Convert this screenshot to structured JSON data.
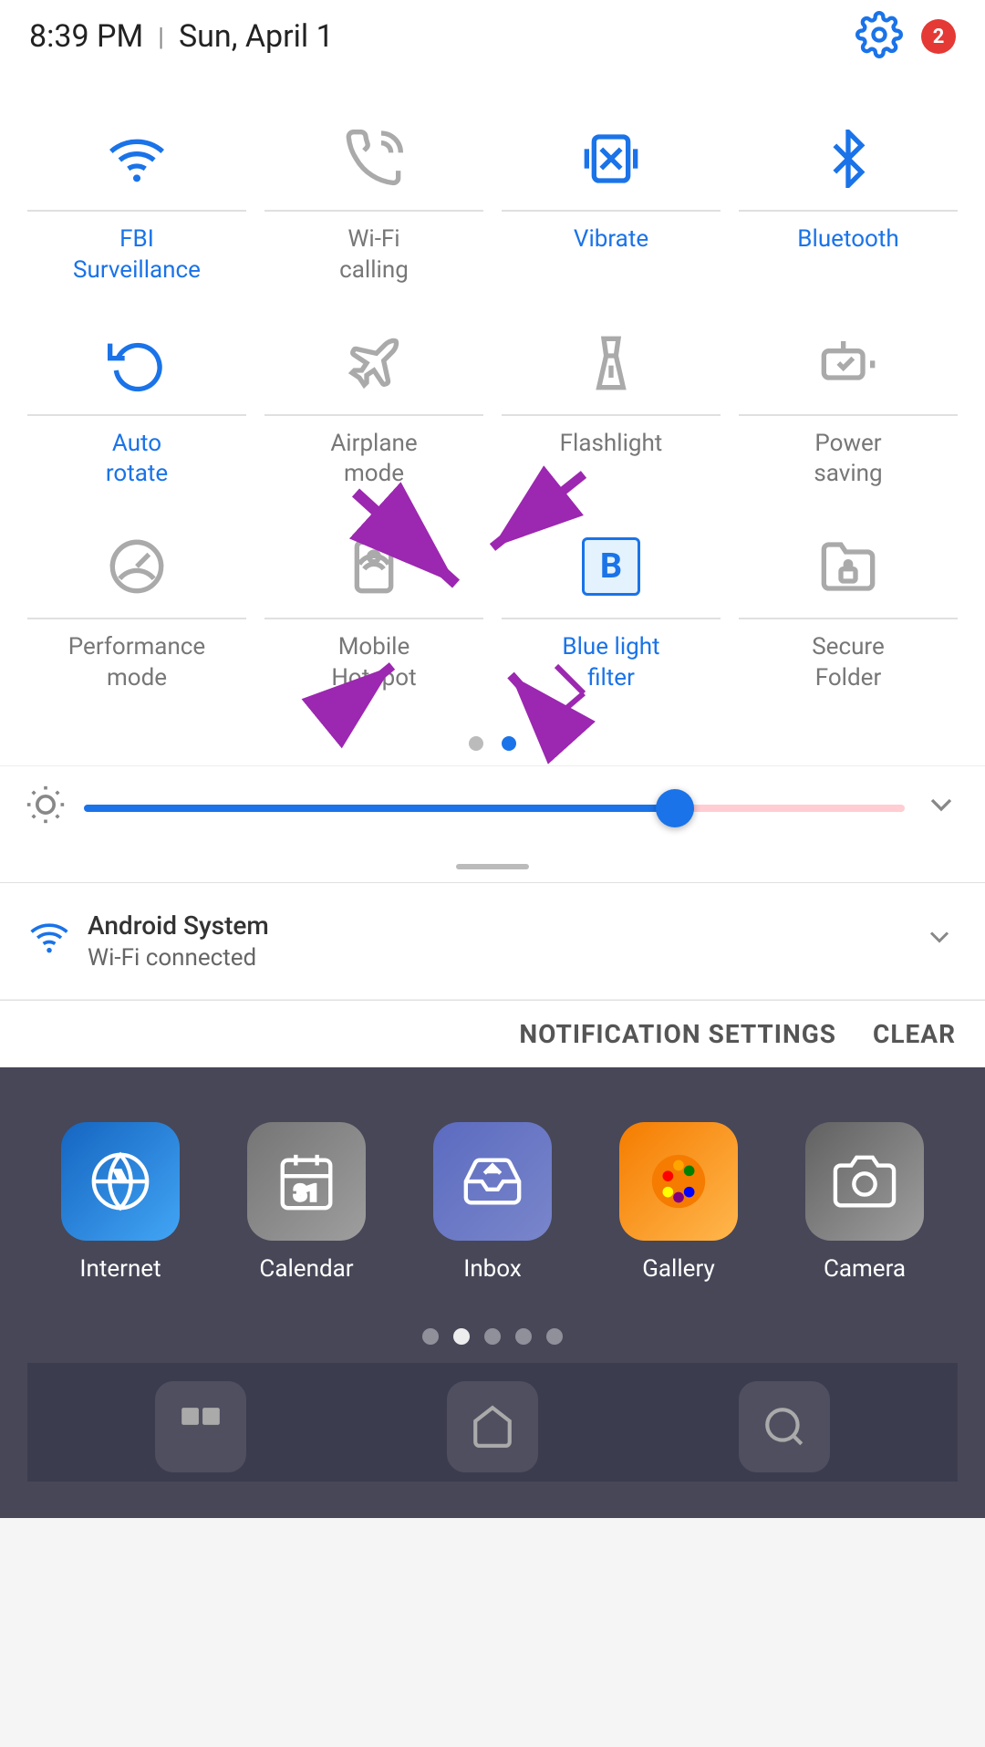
{
  "statusBar": {
    "time": "8:39 PM",
    "separator": "|",
    "date": "Sun, April 1",
    "notifCount": "2"
  },
  "quickSettings": {
    "items": [
      {
        "id": "fbi-surveillance",
        "label": "FBI\nSurveillance",
        "active": true,
        "icon": "wifi"
      },
      {
        "id": "wifi-calling",
        "label": "Wi-Fi\ncalling",
        "active": false,
        "icon": "wifi-calling"
      },
      {
        "id": "vibrate",
        "label": "Vibrate",
        "active": true,
        "icon": "vibrate"
      },
      {
        "id": "bluetooth",
        "label": "Bluetooth",
        "active": true,
        "icon": "bluetooth"
      },
      {
        "id": "auto-rotate",
        "label": "Auto\nrotate",
        "active": true,
        "icon": "auto-rotate"
      },
      {
        "id": "airplane-mode",
        "label": "Airplane\nmode",
        "active": false,
        "icon": "airplane"
      },
      {
        "id": "flashlight",
        "label": "Flashlight",
        "active": false,
        "icon": "flashlight"
      },
      {
        "id": "power-saving",
        "label": "Power\nsaving",
        "active": false,
        "icon": "battery"
      },
      {
        "id": "performance-mode",
        "label": "Performance\nmode",
        "active": false,
        "icon": "speedometer"
      },
      {
        "id": "mobile-hotspot",
        "label": "Mobile\nHotspot",
        "active": false,
        "icon": "hotspot"
      },
      {
        "id": "blue-light-filter",
        "label": "Blue light\nfilter",
        "active": true,
        "icon": "blue-light"
      },
      {
        "id": "secure-folder",
        "label": "Secure\nFolder",
        "active": false,
        "icon": "secure-folder"
      }
    ]
  },
  "brightness": {
    "value": 72
  },
  "paginationDots": {
    "count": 2,
    "active": 1
  },
  "notification": {
    "source": "Android System",
    "status": "Wi-Fi connected"
  },
  "notifActions": {
    "settings": "NOTIFICATION SETTINGS",
    "clear": "CLEAR"
  },
  "apps": [
    {
      "id": "internet",
      "label": "Internet",
      "emoji": "🧭"
    },
    {
      "id": "calendar",
      "label": "Calendar",
      "emoji": "📅"
    },
    {
      "id": "inbox",
      "label": "Inbox",
      "emoji": "✉️"
    },
    {
      "id": "gallery",
      "label": "Gallery",
      "emoji": "🎨"
    },
    {
      "id": "camera",
      "label": "Camera",
      "emoji": "📷"
    }
  ],
  "homeDots": {
    "count": 5,
    "active": 1
  }
}
